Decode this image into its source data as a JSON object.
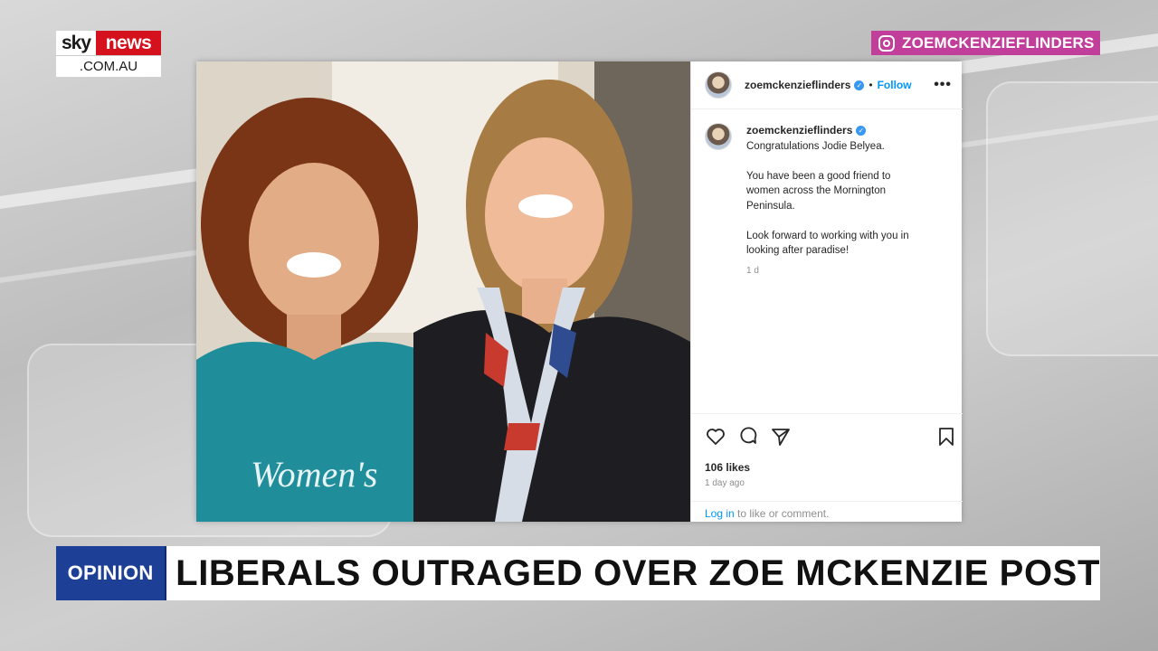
{
  "broadcast": {
    "logo_sky": "sky",
    "logo_news": "news",
    "logo_domain": ".COM.AU",
    "ig_handle_tag": "ZOEMCKENZIEFLINDERS",
    "lower_third_tag": "OPINION",
    "headline": "LIBERALS OUTRAGED OVER ZOE MCKENZIE POST",
    "colors": {
      "sky_red": "#d4111c",
      "ig_magenta": "#c13f9a",
      "opinion_blue": "#1d3f95"
    }
  },
  "post": {
    "header": {
      "username": "zoemckenzieflinders",
      "separator": "•",
      "follow_label": "Follow",
      "more_icon": "more-options-icon"
    },
    "caption": {
      "username": "zoemckenzieflinders",
      "line1": "Congratulations Jodie Belyea.",
      "para2_line1": "You have been a good friend to",
      "para2_line2": "women across the Mornington",
      "para2_line3": "Peninsula.",
      "para3_line1": "Look forward to working with you in",
      "para3_line2": "looking after paradise!",
      "timestamp": "1 d"
    },
    "actions": {
      "icons": [
        "heart-icon",
        "comment-icon",
        "share-icon",
        "bookmark-icon"
      ],
      "likes": "106 likes",
      "time_ago": "1 day ago",
      "login_link": "Log in",
      "login_suffix": " to like or comment."
    },
    "photo": {
      "shirt_text": "Women's"
    }
  }
}
